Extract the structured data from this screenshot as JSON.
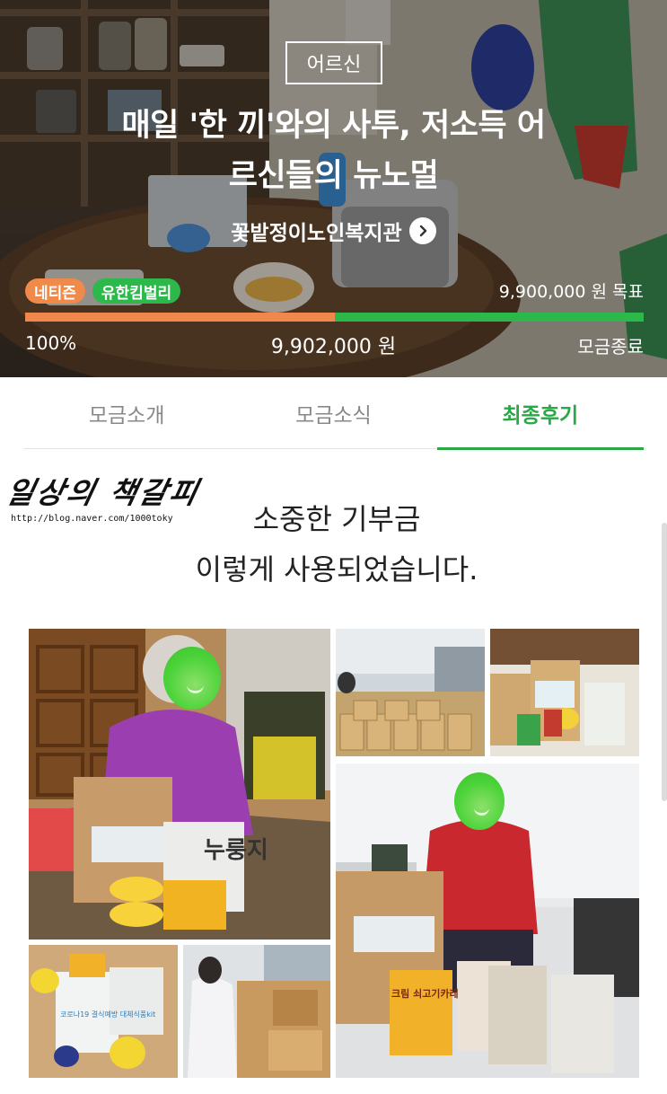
{
  "campaign": {
    "category": "어르신",
    "title_line1": "매일 '한 끼'와의 사투, 저소득 어",
    "title_line2": "르신들의 뉴노멀",
    "organization": "꽃밭정이노인복지관",
    "sponsors": [
      "네티즌",
      "유한킴벌리"
    ],
    "goal": "9,900,000 원 목표",
    "raised": "9,902,000 원",
    "percent_label": "100%",
    "netizen_share_fraction": 0.5,
    "status": "모금종료"
  },
  "tabs": [
    {
      "label": "모금소개",
      "active": false
    },
    {
      "label": "모금소식",
      "active": false
    },
    {
      "label": "최종후기",
      "active": true
    }
  ],
  "review": {
    "blog_name": "일상의 책갈피",
    "blog_url": "http://blog.naver.com/1000toky",
    "headline_line1": "소중한 기부금",
    "headline_line2": "이렇게 사용되었습니다.",
    "photo_text": {
      "package_brand": "크림 쇠고기카레",
      "nurungji": "누룽지",
      "bag_label": "코로나19 결식예방 대체식품kit"
    }
  },
  "colors": {
    "accent_green": "#2aa845",
    "progress_orange": "#f0884d",
    "progress_green": "#2db84b",
    "face_blur_green": "#4cd33a"
  },
  "icons": {
    "org_arrow": "chevron-right-circle-icon"
  }
}
